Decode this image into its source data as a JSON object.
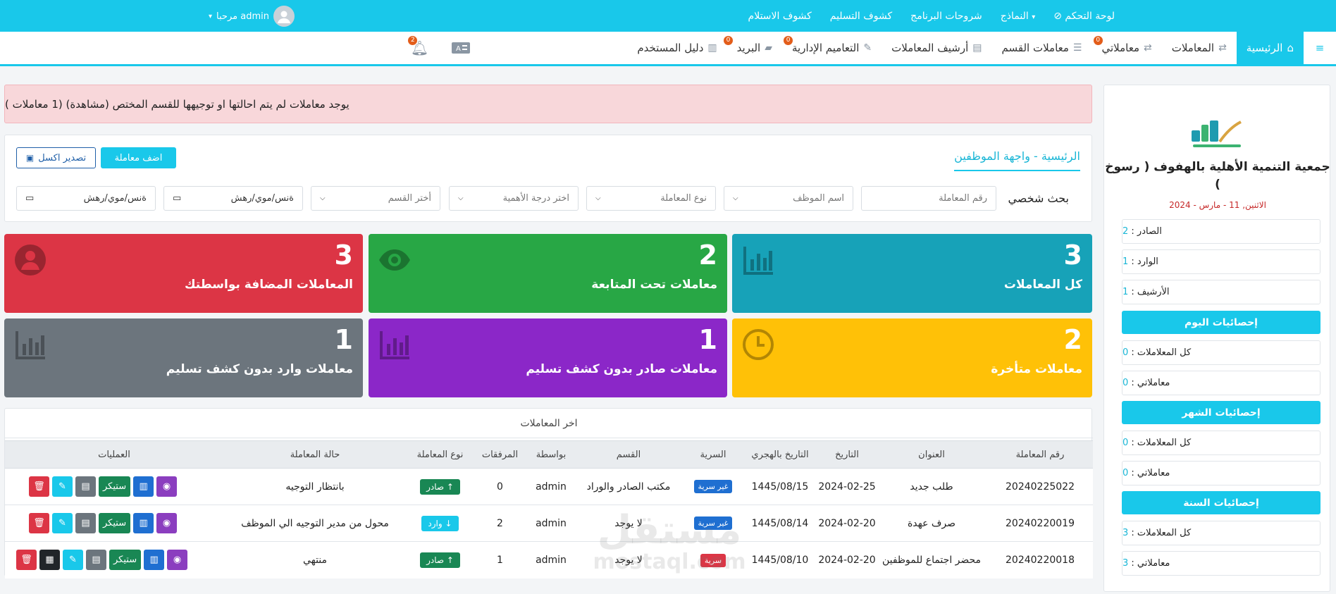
{
  "topbar": {
    "items": [
      "لوحة التحكم",
      "النماذج",
      "شروحات البرنامج",
      "كشوف التسليم",
      "كشوف الاستلام"
    ],
    "user": "مرحبا admin"
  },
  "nav": {
    "items": [
      {
        "label": "الرئيسية",
        "badge": ""
      },
      {
        "label": "المعاملات",
        "badge": ""
      },
      {
        "label": "معاملاتي",
        "badge": "0"
      },
      {
        "label": "معاملات القسم",
        "badge": ""
      },
      {
        "label": "أرشيف المعاملات",
        "badge": ""
      },
      {
        "label": "التعاميم الإدارية",
        "badge": "0"
      },
      {
        "label": "البريد",
        "badge": "0"
      },
      {
        "label": "دليل المستخدم",
        "badge": ""
      }
    ],
    "notif_badge": "2"
  },
  "alert": "يوجد معاملات لم يتم احالتها او توجيهها للقسم المختص (مشاهدة) (1 معاملات )",
  "filter": {
    "breadcrumb": "الرئيسية - واجهة الموظفين",
    "add_button": "اضف معاملة",
    "excel_button": "تصدير اكسل",
    "personal_search": "بحث شخصي",
    "txn_number_placeholder": "رقم المعاملة",
    "employee_placeholder": "اسم الموظف",
    "type_placeholder": "نوع المعاملة",
    "importance_placeholder": "اختر درجة الأهمية",
    "dept_placeholder": "أختر القسم",
    "date_placeholder_1": "ةنس/موي/رهش",
    "date_placeholder_2": "ةنس/موي/رهش"
  },
  "cards": [
    {
      "value": "3",
      "label": "كل المعاملات",
      "color": "#17a2b8",
      "icon": "chart-icon"
    },
    {
      "value": "2",
      "label": "معاملات تحت المتابعة",
      "color": "#28a745",
      "icon": "eye-icon"
    },
    {
      "value": "3",
      "label": "المعاملات المضافة بواسطتك",
      "color": "#dc3545",
      "icon": "user-icon"
    },
    {
      "value": "2",
      "label": "معاملات متأخرة",
      "color": "#ffc107",
      "icon": "clock-icon"
    },
    {
      "value": "1",
      "label": "معاملات صادر بدون كشف تسليم",
      "color": "#8b27c8",
      "icon": "chart-icon"
    },
    {
      "value": "1",
      "label": "معاملات وارد بدون كشف تسليم",
      "color": "#6c757d",
      "icon": "chart-icon"
    }
  ],
  "table": {
    "title": "اخر المعاملات",
    "headers": [
      "رقم المعاملة",
      "العنوان",
      "التاريخ",
      "التاريخ بالهجري",
      "السرية",
      "القسم",
      "بواسطة",
      "المرفقات",
      "نوع المعاملة",
      "حالة المعاملة",
      "العمليات"
    ],
    "rows": [
      {
        "number": "20240225022",
        "title": "طلب جديد",
        "date": "2024-02-25",
        "hijri": "1445/08/15",
        "secrecy": "غير سرية",
        "dept": "مكتب الصادر والوراد",
        "by": "admin",
        "attachments": "0",
        "type": "صادر ↑",
        "status": "بانتظار التوجيه",
        "sticker": "ستيكر"
      },
      {
        "number": "20240220019",
        "title": "صرف عهدة",
        "date": "2024-02-20",
        "hijri": "1445/08/14",
        "secrecy": "غير سرية",
        "dept": "لا يوجد",
        "by": "admin",
        "attachments": "2",
        "type": "وارد ↓",
        "status": "محول من مدير التوجيه الي الموظف",
        "sticker": "ستيكر"
      },
      {
        "number": "20240220018",
        "title": "محضر اجتماع للموظفين",
        "date": "2024-02-20",
        "hijri": "1445/08/10",
        "secrecy": "سرية",
        "dept": "لا يوجد",
        "by": "admin",
        "attachments": "1",
        "type": "صادر ↑",
        "status": "منتهي",
        "sticker": "ستيكر"
      }
    ]
  },
  "sidebar": {
    "org_name": "جمعية التنمية الأهلية بالهفوف ( رسوخ )",
    "date": "الاثنين, 11 - مارس - 2024",
    "outgoing_label": "الصادر :",
    "outgoing_value": "2",
    "incoming_label": "الوارد :",
    "incoming_value": "1",
    "archive_label": "الأرشيف :",
    "archive_value": "1",
    "today_title": "إحصائيات اليوم",
    "month_title": "إحصائيات الشهر",
    "year_title": "إحصائيات السنة",
    "all_label": "كل المعلاملات :",
    "mine_label": "معاملاتي :",
    "today_all": "0",
    "today_mine": "0",
    "month_all": "0",
    "month_mine": "0",
    "year_all": "3",
    "year_mine": "3"
  },
  "watermark": {
    "line1": "مستقل",
    "line2": "mostaql.com"
  }
}
